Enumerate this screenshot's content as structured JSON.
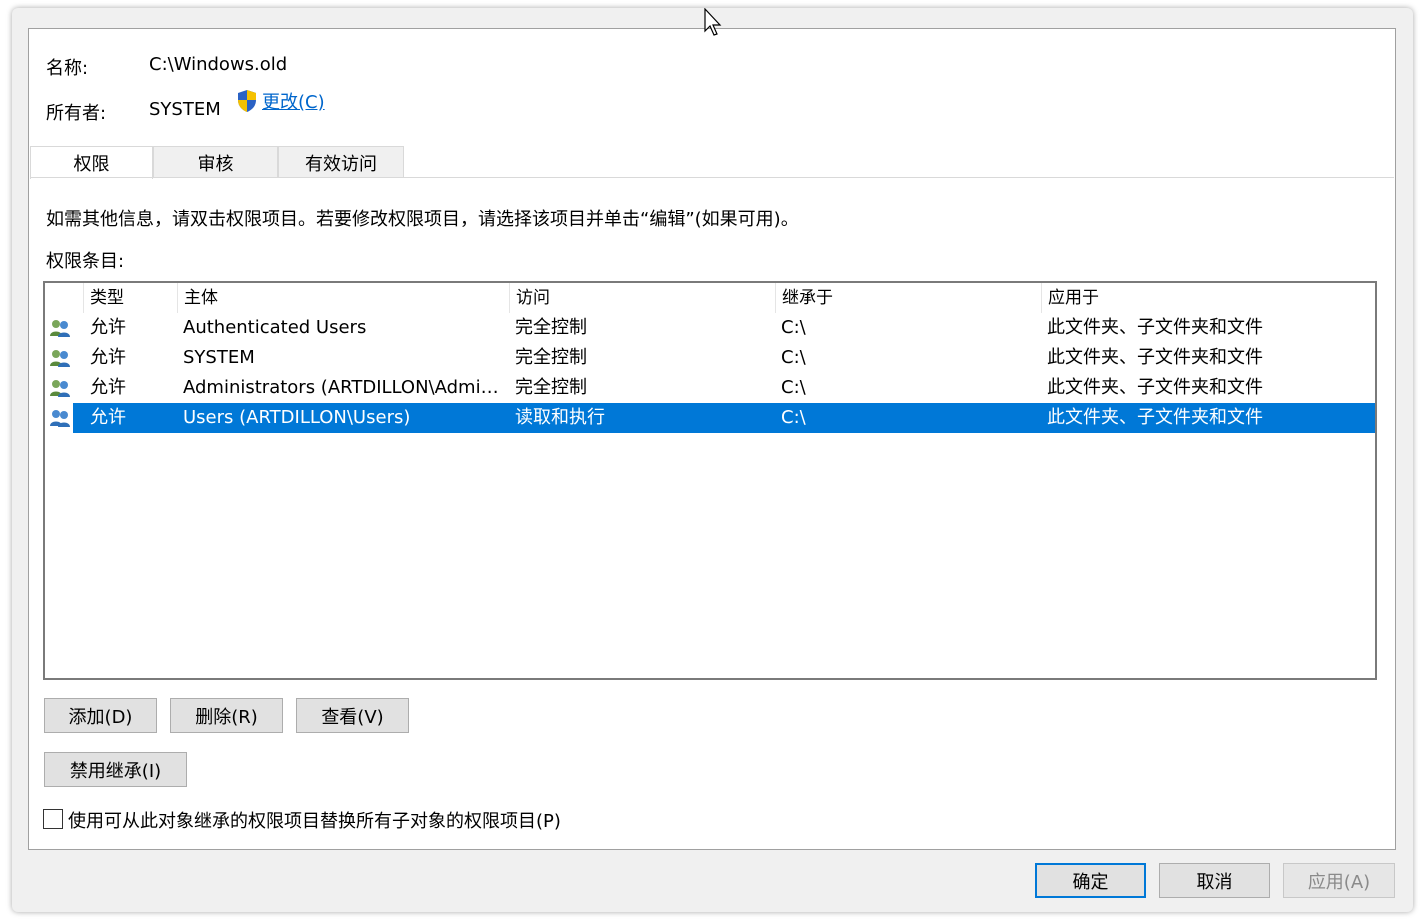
{
  "object": {
    "name_label": "名称:",
    "name_value": "C:\\Windows.old",
    "owner_label": "所有者:",
    "owner_value": "SYSTEM",
    "change_link": "更改(C)"
  },
  "tabs": [
    {
      "label": "权限",
      "active": true
    },
    {
      "label": "审核",
      "active": false
    },
    {
      "label": "有效访问",
      "active": false
    }
  ],
  "info_text": "如需其他信息，请双击权限项目。若要修改权限项目，请选择该项目并单击“编辑”(如果可用)。",
  "entries_label": "权限条目:",
  "table": {
    "columns": [
      "类型",
      "主体",
      "访问",
      "继承于",
      "应用于"
    ],
    "rows": [
      {
        "type": "允许",
        "principal": "Authenticated Users",
        "access": "完全控制",
        "inherited": "C:\\",
        "applies": "此文件夹、子文件夹和文件",
        "selected": false
      },
      {
        "type": "允许",
        "principal": "SYSTEM",
        "access": "完全控制",
        "inherited": "C:\\",
        "applies": "此文件夹、子文件夹和文件",
        "selected": false
      },
      {
        "type": "允许",
        "principal": "Administrators (ARTDILLON\\Admin...",
        "access": "完全控制",
        "inherited": "C:\\",
        "applies": "此文件夹、子文件夹和文件",
        "selected": false
      },
      {
        "type": "允许",
        "principal": "Users (ARTDILLON\\Users)",
        "access": "读取和执行",
        "inherited": "C:\\",
        "applies": "此文件夹、子文件夹和文件",
        "selected": true
      }
    ]
  },
  "buttons": {
    "add": "添加(D)",
    "remove": "删除(R)",
    "view": "查看(V)",
    "disable_inheritance": "禁用继承(I)",
    "ok": "确定",
    "cancel": "取消",
    "apply": "应用(A)"
  },
  "replace_checkbox": {
    "label": "使用可从此对象继承的权限项目替换所有子对象的权限项目(P)",
    "checked": false
  },
  "colors": {
    "selection": "#0078d7",
    "link": "#0066cc"
  }
}
